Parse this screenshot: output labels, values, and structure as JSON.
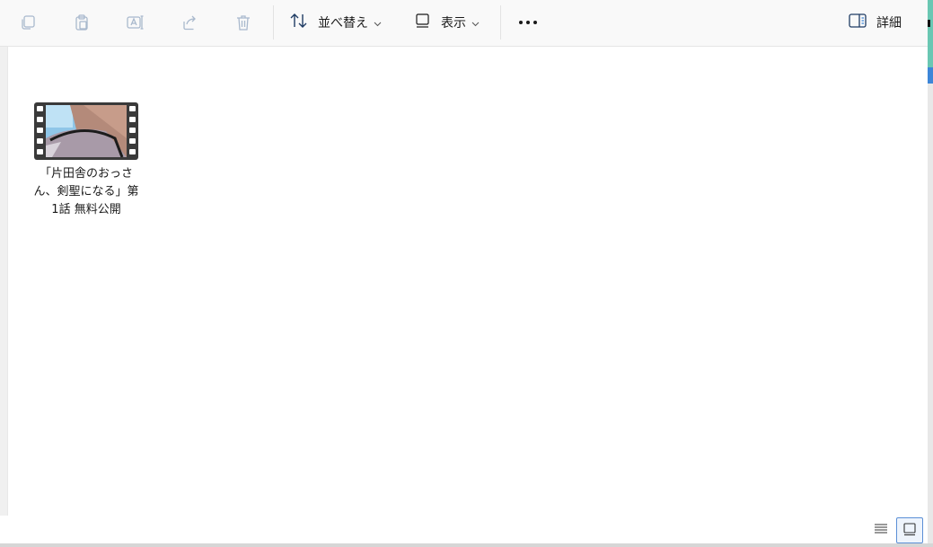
{
  "toolbar": {
    "copy_icon": "copy-icon",
    "paste_icon": "paste-icon",
    "rename_icon": "rename-icon",
    "share_icon": "share-icon",
    "delete_icon": "trash-icon",
    "sort_label": "並べ替え",
    "view_label": "表示",
    "more_icon": "more-icon",
    "details_label": "詳細"
  },
  "files": [
    {
      "name_line1": "「片田舎のおっさ",
      "name_line2": "ん、剣聖になる」第",
      "name_line3": "1話 無料公開",
      "type": "video"
    }
  ],
  "statusbar": {
    "details_view_icon": "list-view-icon",
    "thumbnail_view_icon": "large-icons-view-icon"
  },
  "colors": {
    "toolbar_bg": "#f9f9f9",
    "accent": "#5b8fd6",
    "icon_disabled": "#a8b8cc"
  }
}
